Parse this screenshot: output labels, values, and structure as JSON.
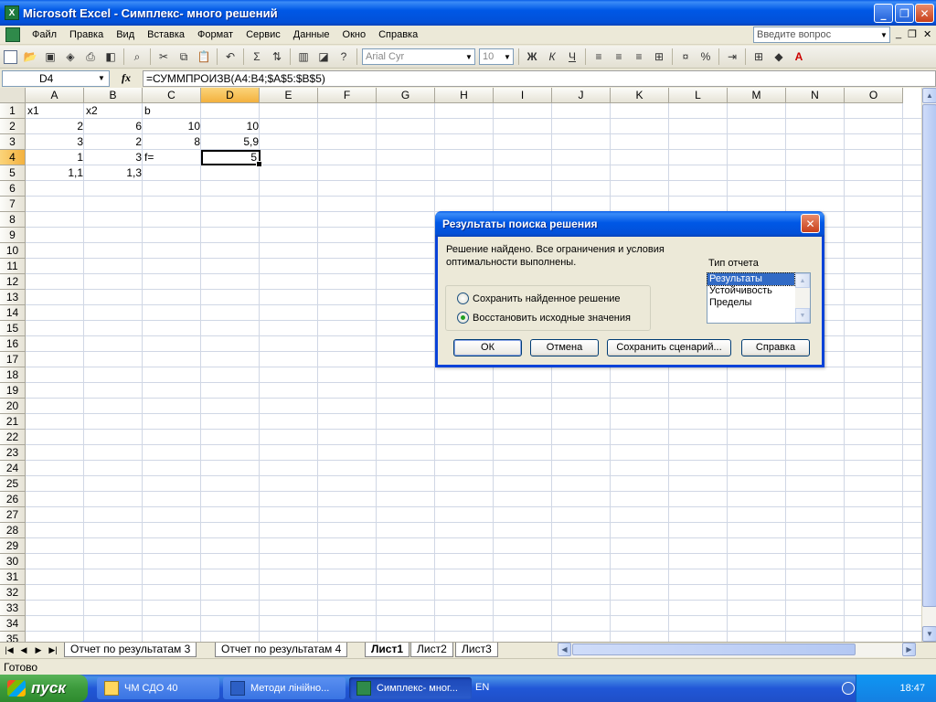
{
  "window": {
    "title": "Microsoft Excel - Симплекс- много решений"
  },
  "menu": {
    "items": [
      "Файл",
      "Правка",
      "Вид",
      "Вставка",
      "Формат",
      "Сервис",
      "Данные",
      "Окно",
      "Справка"
    ],
    "question_placeholder": "Введите вопрос"
  },
  "toolbar": {
    "font": "Arial Cyr",
    "size": "10",
    "bold": "Ж",
    "italic": "К",
    "underline": "Ч",
    "percent": "%",
    "sigma": "Σ",
    "fx": "fx"
  },
  "formula_bar": {
    "name_box": "D4",
    "formula": "=СУММПРОИЗВ(A4:B4;$A$5:$B$5)"
  },
  "sheet": {
    "columns": [
      "A",
      "B",
      "C",
      "D",
      "E",
      "F",
      "G",
      "H",
      "I",
      "J",
      "K",
      "L",
      "M",
      "N",
      "O"
    ],
    "selected_column": "D",
    "selected_row": 4,
    "row_count": 35,
    "cells": {
      "A1": "x1",
      "B1": "x2",
      "C1": "b",
      "A2": "2",
      "B2": "6",
      "C2": "10",
      "D2": "10",
      "A3": "3",
      "B3": "2",
      "C3": "8",
      "D3": "5,9",
      "A4": "1",
      "B4": "3",
      "C4": "f=",
      "D4": "5",
      "A5": "1,1",
      "B5": "1,3"
    }
  },
  "dialog": {
    "title": "Результаты поиска решения",
    "message": "Решение найдено. Все ограничения и условия оптимальности выполнены.",
    "radio_keep": "Сохранить найденное решение",
    "radio_restore": "Восстановить исходные значения",
    "selected_radio": "restore",
    "report_type_label": "Тип отчета",
    "reports": [
      "Результаты",
      "Устойчивость",
      "Пределы"
    ],
    "selected_report": "Результаты",
    "buttons": {
      "ok": "ОК",
      "cancel": "Отмена",
      "save_scenario": "Сохранить сценарий...",
      "help": "Справка"
    }
  },
  "sheet_tabs": {
    "tabs": [
      "Отчет по результатам 3",
      "Отчет по результатам 4",
      "Лист1",
      "Лист2",
      "Лист3"
    ],
    "active": "Лист1"
  },
  "status": {
    "text": "Готово"
  },
  "taskbar": {
    "start": "пуск",
    "tasks": [
      "ЧМ СДО 40",
      "Методи лінійно...",
      "Симплекс- мног..."
    ],
    "active_task": "Симплекс- мног...",
    "language": "EN",
    "clock": "18:47"
  }
}
